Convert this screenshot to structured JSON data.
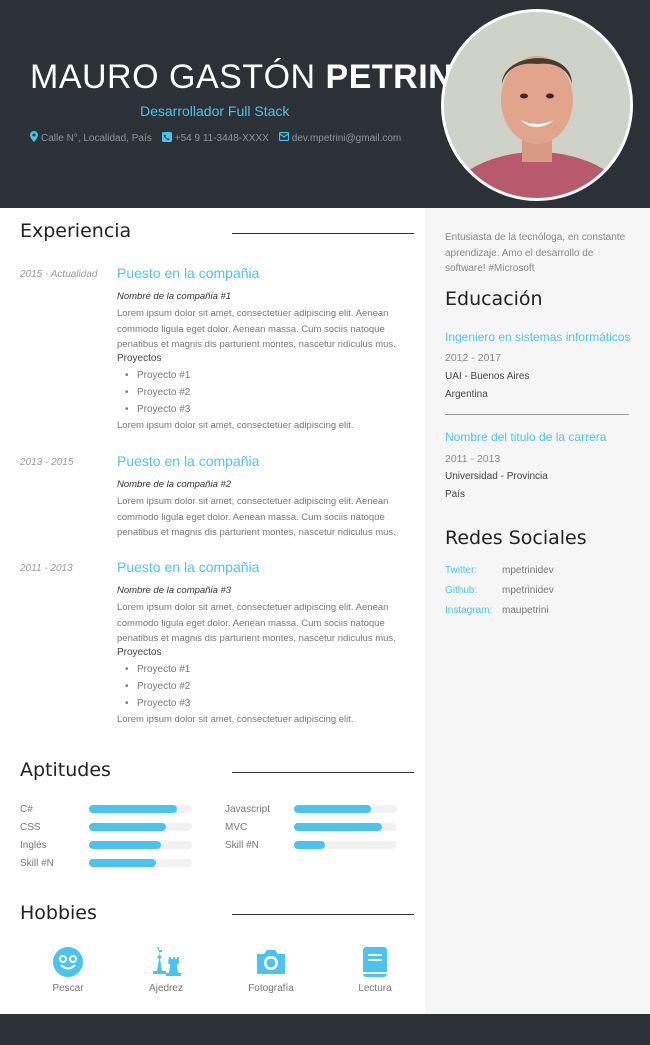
{
  "header": {
    "first_name": "MAURO GASTÓN",
    "last_name": "PETRINI",
    "role": "Desarrollador Full Stack",
    "address": "Calle N°, Localidad, País",
    "phone": "+54 9 11-3448-XXXX",
    "email": "dev.mpetrini@gmail.com"
  },
  "experience": {
    "title": "Experiencia",
    "jobs": [
      {
        "date": "2015 - Actualidad",
        "title": "Puesto en la compañia",
        "company": "Nombre de la compañia #1",
        "desc": "Lorem ipsum dolor sit amet, consectetuer adipiscing elit. Aenean commodo ligula eget dolor. Aenean massa. Cum sociis natoque penatibus et magnis dis parturient montes, nascetur ridiculus mus.",
        "projects_title": "Proyectos",
        "projects": [
          "Proyecto #1",
          "Proyecto #2",
          "Proyecto #3"
        ],
        "end": "Lorem ipsum dolor sit amet, consectetuer adipiscing elit."
      },
      {
        "date": "2013 - 2015",
        "title": "Puesto en la compañia",
        "company": "Nombre de la compañia #2",
        "desc": "Lorem ipsum dolor sit amet, consectetuer adipiscing elit. Aenean commodo ligula eget dolor. Aenean massa. Cum sociis natoque penatibus et magnis dis parturient montes, nascetur ridiculus mus."
      },
      {
        "date": "2011 - 2013",
        "title": "Puesto en la compañia",
        "company": "Nombre de la compañia #3",
        "desc": "Lorem ipsum dolor sit amet, consectetuer adipiscing elit. Aenean commodo ligula eget dolor. Aenean massa. Cum sociis natoque penatibus et magnis dis parturient montes, nascetur ridiculus mus.",
        "projects_title": "Proyectos",
        "projects": [
          "Proyecto #1",
          "Proyecto #2",
          "Proyecto #3"
        ],
        "end": "Lorem ipsum dolor sit amet, consectetuer adipiscing elit."
      }
    ]
  },
  "skills": {
    "title": "Aptitudes",
    "items": [
      {
        "name": "C#",
        "level": 0.85
      },
      {
        "name": "Javascript",
        "level": 0.75
      },
      {
        "name": "CSS",
        "level": 0.75
      },
      {
        "name": "MVC",
        "level": 0.85
      },
      {
        "name": "Inglés",
        "level": 0.7
      },
      {
        "name": "Skill #N",
        "level": 0.3
      },
      {
        "name": "Skill #N",
        "level": 0.65
      }
    ]
  },
  "hobbies": {
    "title": "Hobbies",
    "items": [
      {
        "label": "Pescar",
        "icon": "smiley-icon"
      },
      {
        "label": "Ajedrez",
        "icon": "chess-icon"
      },
      {
        "label": "Fotografía",
        "icon": "camera-icon"
      },
      {
        "label": "Lectura",
        "icon": "book-icon"
      }
    ]
  },
  "sidebar": {
    "about": "Entusiasta de la tecnóloga, en constante aprendizaje. Amo el desarrollo de software! #Microsoft",
    "education_title": "Educación",
    "education": [
      {
        "title": "Ingeniero en sistemas informáticos",
        "years": "2012 - 2017",
        "place": "UAI - Buenos Aires",
        "country": "Argentina"
      },
      {
        "title": "Nombre del titulo de la carrera",
        "years": "2011 - 2013",
        "place": "Universidad - Provincia",
        "country": "País"
      }
    ],
    "social_title": "Redes Sociales",
    "social": [
      {
        "network": "Twitter:",
        "handle": "mpetrinidev"
      },
      {
        "network": "Github:",
        "handle": "mpetrinidev"
      },
      {
        "network": "Instagram:",
        "handle": "maupetrini"
      }
    ]
  },
  "colors": {
    "accent": "#4cc3ec",
    "dark": "#2c3138",
    "sidebar": "#f6f6f6"
  }
}
